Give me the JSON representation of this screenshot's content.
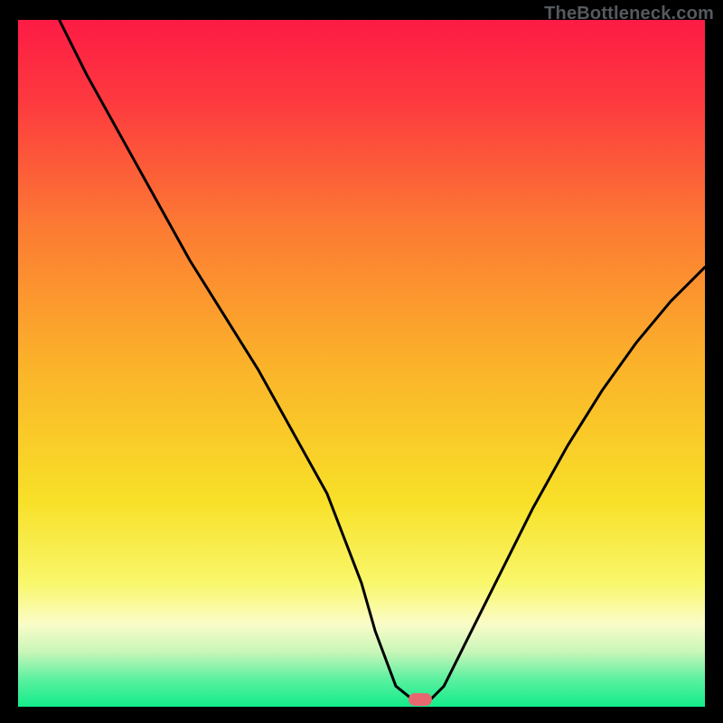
{
  "watermark": "TheBottleneck.com",
  "colors": {
    "bg": "#000000",
    "gradient_stops": [
      {
        "offset": 0.0,
        "color": "#fd1b45"
      },
      {
        "offset": 0.12,
        "color": "#fd3a3f"
      },
      {
        "offset": 0.3,
        "color": "#fc7a33"
      },
      {
        "offset": 0.5,
        "color": "#fbb22a"
      },
      {
        "offset": 0.7,
        "color": "#f8e028"
      },
      {
        "offset": 0.82,
        "color": "#f9f76b"
      },
      {
        "offset": 0.88,
        "color": "#fafcc8"
      },
      {
        "offset": 0.92,
        "color": "#c9f6b9"
      },
      {
        "offset": 0.96,
        "color": "#5bf0a0"
      },
      {
        "offset": 1.0,
        "color": "#13ec8a"
      }
    ],
    "curve": "#000000",
    "marker": "#e8686f"
  },
  "chart_data": {
    "type": "line",
    "title": "",
    "xlabel": "",
    "ylabel": "",
    "xlim": [
      0,
      100
    ],
    "ylim": [
      0,
      100
    ],
    "series": [
      {
        "name": "curve",
        "x": [
          6,
          10,
          15,
          20,
          25,
          30,
          35,
          40,
          45,
          50,
          52,
          55,
          57.5,
          60,
          62,
          65,
          70,
          75,
          80,
          85,
          90,
          95,
          100
        ],
        "y": [
          100,
          92,
          83,
          74,
          65,
          57,
          49,
          40,
          31,
          18,
          11,
          3,
          1,
          1,
          3,
          9,
          19,
          29,
          38,
          46,
          53,
          59,
          64
        ]
      }
    ],
    "marker": {
      "x": 58.5,
      "y": 1
    },
    "grid": false,
    "legend": false
  }
}
